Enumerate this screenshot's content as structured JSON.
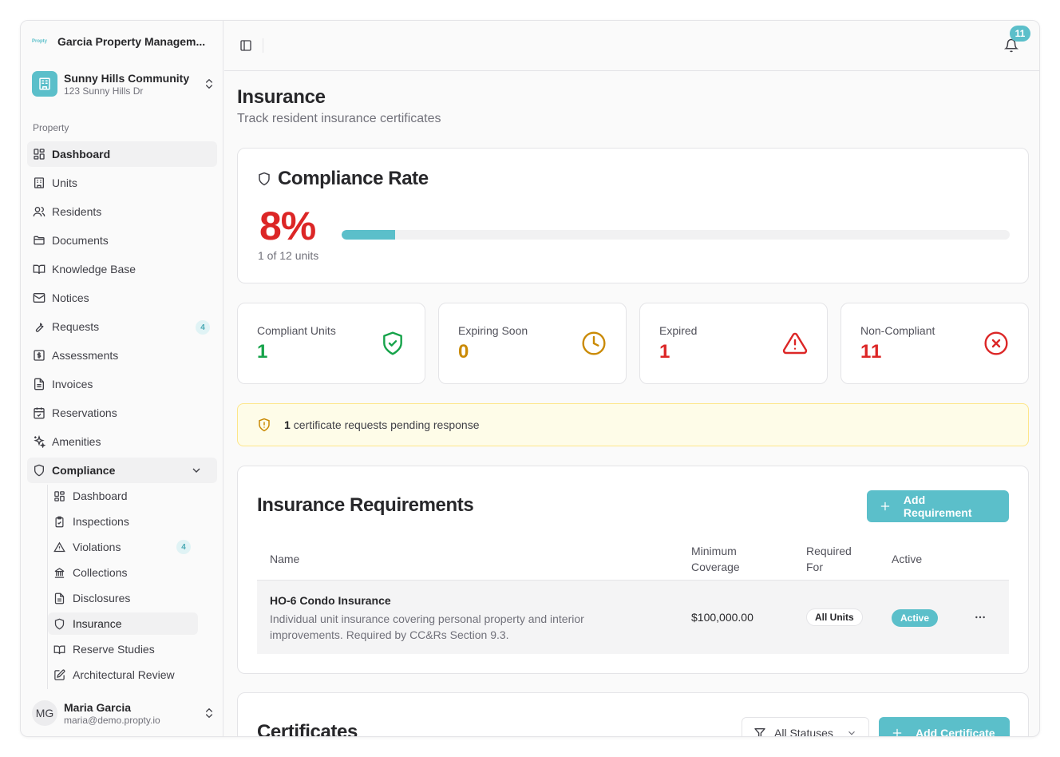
{
  "org": {
    "logo_text": "Propty",
    "name": "Garcia Property Managem..."
  },
  "community": {
    "name": "Sunny Hills Community",
    "address": "123 Sunny Hills Dr"
  },
  "sidebar": {
    "section_label": "Property",
    "items": [
      {
        "label": "Dashboard",
        "icon": "dashboard-icon"
      },
      {
        "label": "Units",
        "icon": "building-icon"
      },
      {
        "label": "Residents",
        "icon": "users-icon"
      },
      {
        "label": "Documents",
        "icon": "folder-icon"
      },
      {
        "label": "Knowledge Base",
        "icon": "book-icon"
      },
      {
        "label": "Notices",
        "icon": "mail-icon"
      },
      {
        "label": "Requests",
        "icon": "wrench-icon",
        "badge": "4"
      },
      {
        "label": "Assessments",
        "icon": "dollar-icon"
      },
      {
        "label": "Invoices",
        "icon": "file-icon"
      },
      {
        "label": "Reservations",
        "icon": "calendar-icon"
      },
      {
        "label": "Amenities",
        "icon": "sparkles-icon"
      },
      {
        "label": "Compliance",
        "icon": "shield-icon"
      }
    ],
    "compliance_sub": [
      {
        "label": "Dashboard",
        "icon": "dashboard-icon"
      },
      {
        "label": "Inspections",
        "icon": "clipboard-icon"
      },
      {
        "label": "Violations",
        "icon": "warning-icon",
        "badge": "4"
      },
      {
        "label": "Collections",
        "icon": "bank-icon"
      },
      {
        "label": "Disclosures",
        "icon": "file-icon"
      },
      {
        "label": "Insurance",
        "icon": "shield-icon"
      },
      {
        "label": "Reserve Studies",
        "icon": "book-icon"
      },
      {
        "label": "Architectural Review",
        "icon": "edit-icon"
      }
    ]
  },
  "user": {
    "initials": "MG",
    "name": "Maria Garcia",
    "email": "maria@demo.propty.io"
  },
  "header": {
    "notification_count": "11"
  },
  "page": {
    "title": "Insurance",
    "subtitle": "Track resident insurance certificates"
  },
  "compliance": {
    "title": "Compliance Rate",
    "rate": "8%",
    "rate_fraction": 0.08,
    "units_text": "1 of 12 units"
  },
  "stats": [
    {
      "label": "Compliant Units",
      "value": "1",
      "color": "#16a34a",
      "icon": "shield-check-icon"
    },
    {
      "label": "Expiring Soon",
      "value": "0",
      "color": "#ca8a04",
      "icon": "clock-icon"
    },
    {
      "label": "Expired",
      "value": "1",
      "color": "#dc2626",
      "icon": "alert-triangle-icon"
    },
    {
      "label": "Non-Compliant",
      "value": "11",
      "color": "#dc2626",
      "icon": "x-circle-icon"
    }
  ],
  "alert": {
    "count": "1",
    "text": "certificate requests pending response"
  },
  "requirements": {
    "title": "Insurance Requirements",
    "add_label": "Add Requirement",
    "columns": [
      "Name",
      "Minimum Coverage",
      "Required For",
      "Active"
    ],
    "rows": [
      {
        "name": "HO-6 Condo Insurance",
        "description": "Individual unit insurance covering personal property and interior improvements. Required by CC&Rs Section 9.3.",
        "coverage": "$100,000.00",
        "required_for": "All Units",
        "active": "Active"
      }
    ]
  },
  "certificates": {
    "title": "Certificates",
    "filter_label": "All Statuses",
    "add_label": "Add Certificate"
  },
  "colors": {
    "accent": "#5bbfca",
    "danger": "#dc2626",
    "success": "#16a34a",
    "warning": "#ca8a04"
  }
}
